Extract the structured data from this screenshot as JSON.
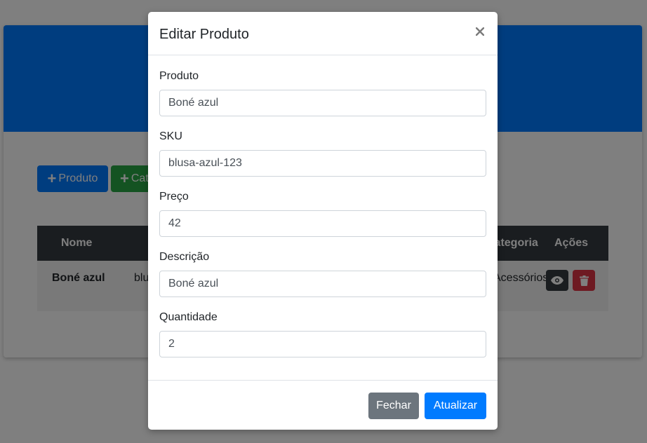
{
  "page": {
    "buttons": {
      "add_produto": "Produto",
      "add_categoria": "Categoria"
    },
    "table": {
      "headers": {
        "nome": "Nome",
        "categoria": "Categoria",
        "acoes": "Ações"
      },
      "rows": [
        {
          "nome": "Boné azul",
          "sku": "blusa-azul-123",
          "categoria": "Acessórios"
        }
      ]
    },
    "icons": {
      "view": "eye-icon",
      "delete": "trash-icon",
      "add": "plus-icon"
    }
  },
  "modal": {
    "title": "Editar Produto",
    "close_icon": "close-icon",
    "fields": {
      "produto": {
        "label": "Produto",
        "value": "Boné azul"
      },
      "sku": {
        "label": "SKU",
        "value": "blusa-azul-123"
      },
      "preco": {
        "label": "Preço",
        "value": "42"
      },
      "descricao": {
        "label": "Descrição",
        "value": "Boné azul"
      },
      "quantidade": {
        "label": "Quantidade",
        "value": "2"
      }
    },
    "buttons": {
      "fechar": "Fechar",
      "atualizar": "Atualizar"
    }
  },
  "colors": {
    "primary": "#007bff",
    "success": "#28a745",
    "secondary": "#6c757d",
    "danger": "#dc3545",
    "dark": "#343a40"
  }
}
